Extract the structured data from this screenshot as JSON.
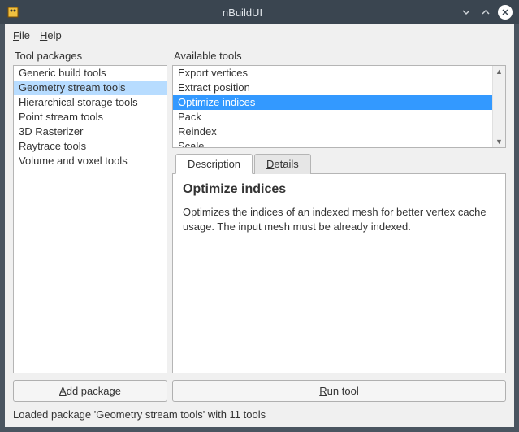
{
  "window": {
    "title": "nBuildUI"
  },
  "menubar": {
    "file": "File",
    "help": "Help"
  },
  "leftcol": {
    "label": "Tool packages",
    "items": [
      "Generic build tools",
      "Geometry stream tools",
      "Hierarchical storage tools",
      "Point stream tools",
      "3D Rasterizer",
      "Raytrace tools",
      "Volume and voxel tools"
    ],
    "selected_index": 1
  },
  "rightcol": {
    "label": "Available tools",
    "items": [
      "Export vertices",
      "Extract position",
      "Optimize indices",
      "Pack",
      "Reindex",
      "Scale"
    ],
    "selected_index": 2
  },
  "tabs": {
    "description": "Description",
    "details": "Details",
    "active": "description"
  },
  "description": {
    "title": "Optimize indices",
    "body": "Optimizes the indices of an indexed mesh for better vertex cache usage. The input mesh must be already indexed."
  },
  "buttons": {
    "add_package": "Add package",
    "run_tool": "Run tool"
  },
  "statusbar": "Loaded package 'Geometry stream tools' with 11 tools"
}
